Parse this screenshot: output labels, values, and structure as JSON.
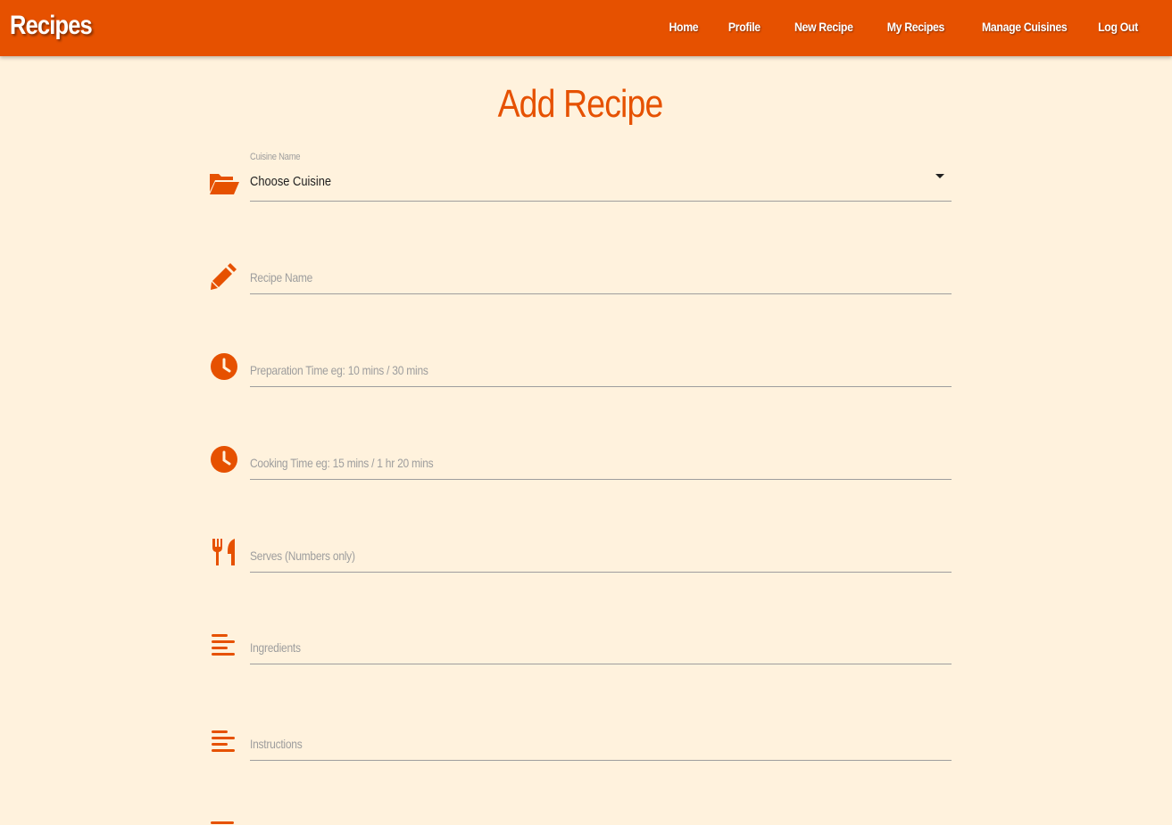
{
  "navbar": {
    "brand": "Recipes",
    "links": [
      "Home",
      "Profile",
      "New Recipe",
      "My Recipes",
      "Manage Cuisines",
      "Log Out"
    ]
  },
  "page": {
    "title": "Add Recipe"
  },
  "form": {
    "cuisine": {
      "label": "Cuisine Name",
      "value": "Choose Cuisine",
      "icon": "folder-open-icon"
    },
    "recipe_name": {
      "placeholder": "Recipe Name",
      "icon": "pencil-icon"
    },
    "prep_time": {
      "placeholder": "Preparation Time eg: 10 mins / 30 mins",
      "icon": "clock-icon"
    },
    "cook_time": {
      "placeholder": "Cooking Time eg: 15 mins / 1 hr 20 mins",
      "icon": "clock-icon"
    },
    "serves": {
      "placeholder": "Serves (Numbers only)",
      "icon": "utensils-icon"
    },
    "ingredients": {
      "placeholder": "Ingredients",
      "icon": "align-left-icon"
    },
    "instructions": {
      "placeholder": "Instructions",
      "icon": "align-left-icon"
    }
  },
  "colors": {
    "accent": "#e65100",
    "background": "#fff2dd",
    "placeholder": "#9e9e9e",
    "underline": "#9e9e9e"
  }
}
